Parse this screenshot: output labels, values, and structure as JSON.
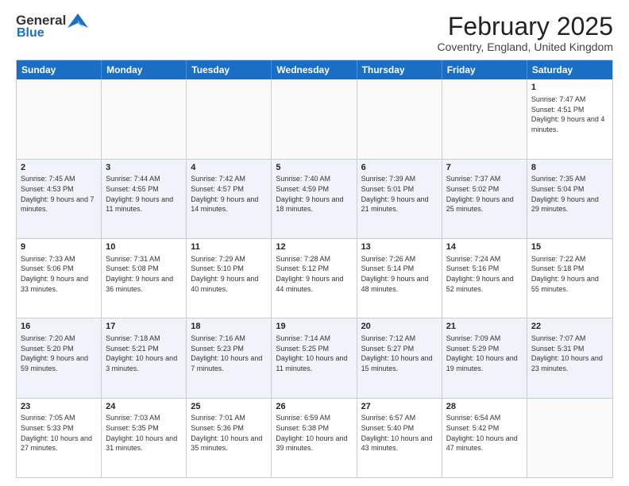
{
  "header": {
    "logo_line1": "General",
    "logo_line2": "Blue",
    "title": "February 2025",
    "subtitle": "Coventry, England, United Kingdom"
  },
  "days_of_week": [
    "Sunday",
    "Monday",
    "Tuesday",
    "Wednesday",
    "Thursday",
    "Friday",
    "Saturday"
  ],
  "weeks": [
    [
      {
        "day": "",
        "empty": true
      },
      {
        "day": "",
        "empty": true
      },
      {
        "day": "",
        "empty": true
      },
      {
        "day": "",
        "empty": true
      },
      {
        "day": "",
        "empty": true
      },
      {
        "day": "",
        "empty": true
      },
      {
        "day": "1",
        "info": "Sunrise: 7:47 AM\nSunset: 4:51 PM\nDaylight: 9 hours and 4 minutes."
      }
    ],
    [
      {
        "day": "2",
        "info": "Sunrise: 7:45 AM\nSunset: 4:53 PM\nDaylight: 9 hours and 7 minutes."
      },
      {
        "day": "3",
        "info": "Sunrise: 7:44 AM\nSunset: 4:55 PM\nDaylight: 9 hours and 11 minutes."
      },
      {
        "day": "4",
        "info": "Sunrise: 7:42 AM\nSunset: 4:57 PM\nDaylight: 9 hours and 14 minutes."
      },
      {
        "day": "5",
        "info": "Sunrise: 7:40 AM\nSunset: 4:59 PM\nDaylight: 9 hours and 18 minutes."
      },
      {
        "day": "6",
        "info": "Sunrise: 7:39 AM\nSunset: 5:01 PM\nDaylight: 9 hours and 21 minutes."
      },
      {
        "day": "7",
        "info": "Sunrise: 7:37 AM\nSunset: 5:02 PM\nDaylight: 9 hours and 25 minutes."
      },
      {
        "day": "8",
        "info": "Sunrise: 7:35 AM\nSunset: 5:04 PM\nDaylight: 9 hours and 29 minutes."
      }
    ],
    [
      {
        "day": "9",
        "info": "Sunrise: 7:33 AM\nSunset: 5:06 PM\nDaylight: 9 hours and 33 minutes."
      },
      {
        "day": "10",
        "info": "Sunrise: 7:31 AM\nSunset: 5:08 PM\nDaylight: 9 hours and 36 minutes."
      },
      {
        "day": "11",
        "info": "Sunrise: 7:29 AM\nSunset: 5:10 PM\nDaylight: 9 hours and 40 minutes."
      },
      {
        "day": "12",
        "info": "Sunrise: 7:28 AM\nSunset: 5:12 PM\nDaylight: 9 hours and 44 minutes."
      },
      {
        "day": "13",
        "info": "Sunrise: 7:26 AM\nSunset: 5:14 PM\nDaylight: 9 hours and 48 minutes."
      },
      {
        "day": "14",
        "info": "Sunrise: 7:24 AM\nSunset: 5:16 PM\nDaylight: 9 hours and 52 minutes."
      },
      {
        "day": "15",
        "info": "Sunrise: 7:22 AM\nSunset: 5:18 PM\nDaylight: 9 hours and 55 minutes."
      }
    ],
    [
      {
        "day": "16",
        "info": "Sunrise: 7:20 AM\nSunset: 5:20 PM\nDaylight: 9 hours and 59 minutes."
      },
      {
        "day": "17",
        "info": "Sunrise: 7:18 AM\nSunset: 5:21 PM\nDaylight: 10 hours and 3 minutes."
      },
      {
        "day": "18",
        "info": "Sunrise: 7:16 AM\nSunset: 5:23 PM\nDaylight: 10 hours and 7 minutes."
      },
      {
        "day": "19",
        "info": "Sunrise: 7:14 AM\nSunset: 5:25 PM\nDaylight: 10 hours and 11 minutes."
      },
      {
        "day": "20",
        "info": "Sunrise: 7:12 AM\nSunset: 5:27 PM\nDaylight: 10 hours and 15 minutes."
      },
      {
        "day": "21",
        "info": "Sunrise: 7:09 AM\nSunset: 5:29 PM\nDaylight: 10 hours and 19 minutes."
      },
      {
        "day": "22",
        "info": "Sunrise: 7:07 AM\nSunset: 5:31 PM\nDaylight: 10 hours and 23 minutes."
      }
    ],
    [
      {
        "day": "23",
        "info": "Sunrise: 7:05 AM\nSunset: 5:33 PM\nDaylight: 10 hours and 27 minutes."
      },
      {
        "day": "24",
        "info": "Sunrise: 7:03 AM\nSunset: 5:35 PM\nDaylight: 10 hours and 31 minutes."
      },
      {
        "day": "25",
        "info": "Sunrise: 7:01 AM\nSunset: 5:36 PM\nDaylight: 10 hours and 35 minutes."
      },
      {
        "day": "26",
        "info": "Sunrise: 6:59 AM\nSunset: 5:38 PM\nDaylight: 10 hours and 39 minutes."
      },
      {
        "day": "27",
        "info": "Sunrise: 6:57 AM\nSunset: 5:40 PM\nDaylight: 10 hours and 43 minutes."
      },
      {
        "day": "28",
        "info": "Sunrise: 6:54 AM\nSunset: 5:42 PM\nDaylight: 10 hours and 47 minutes."
      },
      {
        "day": "",
        "empty": true
      }
    ]
  ]
}
